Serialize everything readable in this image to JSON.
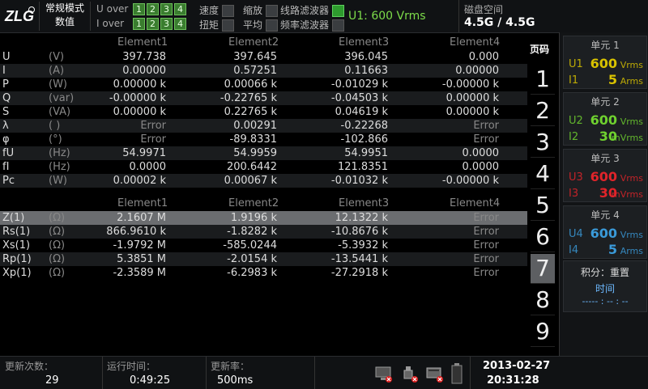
{
  "top": {
    "mode_line1": "常规模式",
    "mode_line2": "数值",
    "u_over_label": "U over",
    "i_over_label": "I over",
    "over_nums": [
      "1",
      "2",
      "3",
      "4"
    ],
    "speed": "速度",
    "integrate": "扭矩",
    "zoom": "缩放",
    "average": "平均",
    "line_filter": "线路滤波器",
    "freq_filter": "频率滤波器",
    "range_label": "U1: 600 Vrms",
    "disk_label": "磁盘空间",
    "disk_value": "4.5G / 4.5G"
  },
  "table1": {
    "headers": [
      "Element1",
      "Element2",
      "Element3",
      "Element4"
    ],
    "rows": [
      {
        "name": "U",
        "unit": "(V)",
        "v": [
          "397.738",
          "397.645",
          "396.045",
          "0.000"
        ]
      },
      {
        "name": "I",
        "unit": "(A)",
        "v": [
          "0.00000",
          "0.57251",
          "0.11663",
          "0.00000"
        ]
      },
      {
        "name": "P",
        "unit": "(W)",
        "v": [
          "0.00000 k",
          "0.00066 k",
          "-0.01029 k",
          "-0.00000 k"
        ]
      },
      {
        "name": "Q",
        "unit": "(var)",
        "v": [
          "-0.00000 k",
          "-0.22765 k",
          "-0.04503 k",
          "0.00000 k"
        ]
      },
      {
        "name": "S",
        "unit": "(VA)",
        "v": [
          "0.00000 k",
          "0.22765 k",
          "0.04619 k",
          "0.00000 k"
        ]
      },
      {
        "name": "λ",
        "unit": "( )",
        "v": [
          "Error",
          "0.00291",
          "-0.22268",
          "Error"
        ]
      },
      {
        "name": "φ",
        "unit": "(°)",
        "v": [
          "Error",
          "-89.8331",
          "-102.866",
          "Error"
        ]
      },
      {
        "name": "fU",
        "unit": "(Hz)",
        "v": [
          "54.9971",
          "54.9959",
          "54.9951",
          "0.0000"
        ]
      },
      {
        "name": "fI",
        "unit": "(Hz)",
        "v": [
          "0.0000",
          "200.6442",
          "121.8351",
          "0.0000"
        ]
      },
      {
        "name": "Pc",
        "unit": "(W)",
        "v": [
          "0.00002 k",
          "0.00067 k",
          "-0.01032 k",
          "-0.00000 k"
        ]
      }
    ]
  },
  "table2": {
    "headers": [
      "Element1",
      "Element2",
      "Element3",
      "Element4"
    ],
    "rows": [
      {
        "name": "Z(1)",
        "unit": "(Ω)",
        "v": [
          "2.1607 M",
          "1.9196 k",
          "12.1322 k",
          "Error"
        ]
      },
      {
        "name": "Rs(1)",
        "unit": "(Ω)",
        "v": [
          "866.9610 k",
          "-1.8282 k",
          "-10.8676 k",
          "Error"
        ]
      },
      {
        "name": "Xs(1)",
        "unit": "(Ω)",
        "v": [
          "-1.9792 M",
          "-585.0244",
          "-5.3932 k",
          "Error"
        ]
      },
      {
        "name": "Rp(1)",
        "unit": "(Ω)",
        "v": [
          "5.3851 M",
          "-2.0154 k",
          "-13.5441 k",
          "Error"
        ]
      },
      {
        "name": "Xp(1)",
        "unit": "(Ω)",
        "v": [
          "-2.3589 M",
          "-6.2983 k",
          "-27.2918 k",
          "Error"
        ]
      }
    ]
  },
  "pages": {
    "title": "页码",
    "items": [
      "1",
      "2",
      "3",
      "4",
      "5",
      "6",
      "7",
      "8",
      "9"
    ],
    "active": "7"
  },
  "units": [
    {
      "title": "单元 1",
      "l1": "U1",
      "v1": "600",
      "u1": "Vrms",
      "l2": "I1",
      "v2": "5",
      "u2": "Arms",
      "color": "#d8c200"
    },
    {
      "title": "单元 2",
      "l1": "U2",
      "v1": "600",
      "u1": "Vrms",
      "l2": "I2",
      "v2": "30",
      "u2": "mVrms",
      "color": "#6fd12f"
    },
    {
      "title": "单元 3",
      "l1": "U3",
      "v1": "600",
      "u1": "Vrms",
      "l2": "I3",
      "v2": "30",
      "u2": "mVrms",
      "color": "#e0242a"
    },
    {
      "title": "单元 4",
      "l1": "U4",
      "v1": "600",
      "u1": "Vrms",
      "l2": "I4",
      "v2": "5",
      "u2": "Arms",
      "color": "#3a9ad9"
    }
  ],
  "integration": {
    "title": "积分：重置",
    "time_label": "时间",
    "time_value": "----- : -- : --"
  },
  "bottom": {
    "update_count_label": "更新次数：",
    "update_count": "29",
    "run_time_label": "运行时间：",
    "run_time": "0:49:25",
    "update_rate_label": "更新率：",
    "update_rate": "500ms",
    "date": "2013-02-27",
    "time": "20:31:28"
  }
}
